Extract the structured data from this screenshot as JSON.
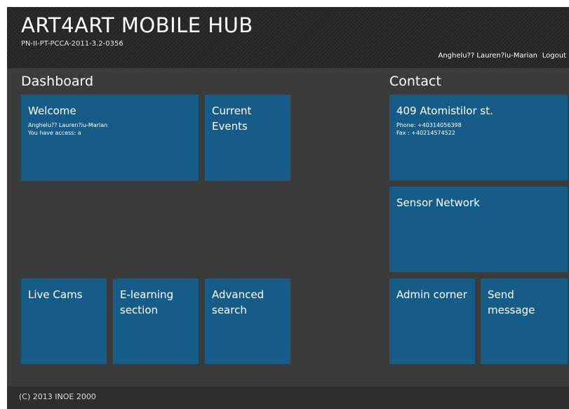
{
  "header": {
    "title": "ART4ART MOBILE HUB",
    "project_code": "PN-II-PT-PCCA-2011-3.2-0356",
    "user_name": "Anghelu?? Lauren?iu-Marian",
    "logout_label": "Logout"
  },
  "dashboard": {
    "title": "Dashboard",
    "welcome": {
      "title": "Welcome",
      "user_line": "Anghelu?? Lauren?iu-Marian",
      "access_line": "You have access: a"
    },
    "current_events": {
      "title_line1": "Current",
      "title_line2": "Events"
    },
    "live_cams": {
      "title": "Live Cams"
    },
    "elearning": {
      "title_line1": "E-learning",
      "title_line2": "section"
    },
    "advanced_search": {
      "title_line1": "Advanced",
      "title_line2": "search"
    }
  },
  "contact": {
    "title": "Contact",
    "address": {
      "title": "409 Atomistilor st.",
      "phone": "Phone: +40314056398",
      "fax": "Fax : +40214574522"
    },
    "sensor_network": {
      "title": "Sensor Network"
    },
    "admin_corner": {
      "title": "Admin corner"
    },
    "send_message": {
      "title_line1": "Send",
      "title_line2": "message"
    }
  },
  "footer": {
    "copyright": "(C) 2013 INOE 2000"
  },
  "colors": {
    "tile": "#155d88",
    "background": "#3b3b3b",
    "header": "#262626"
  }
}
